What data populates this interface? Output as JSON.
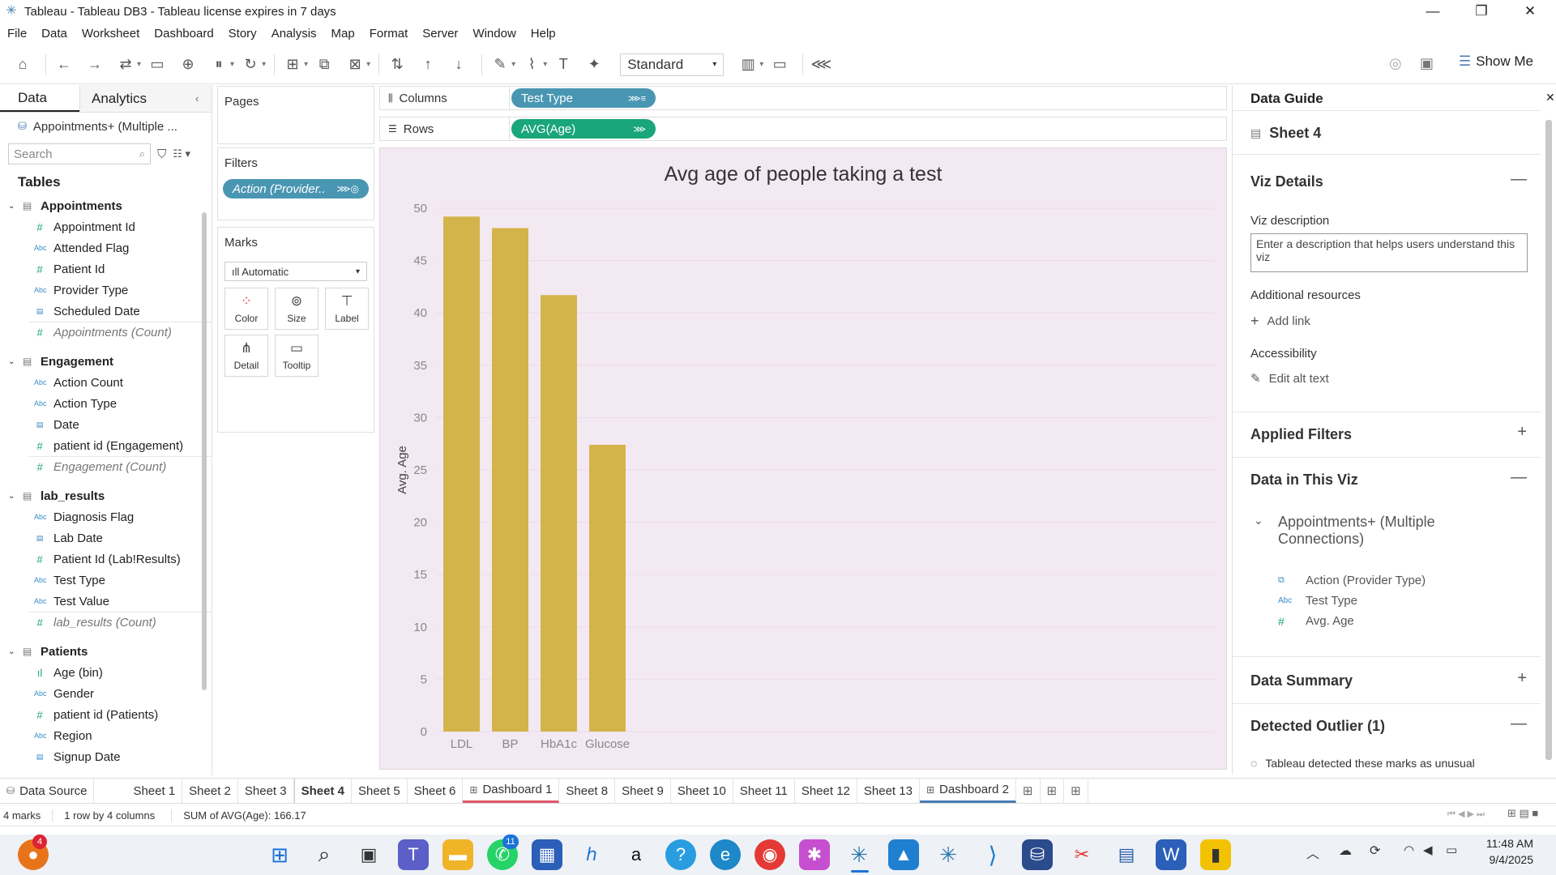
{
  "window": {
    "title": "Tableau - Tableau DB3 - Tableau license expires in 7 days",
    "minimize": "—",
    "restore": "❐",
    "close": "✕"
  },
  "menu": [
    "File",
    "Data",
    "Worksheet",
    "Dashboard",
    "Story",
    "Analysis",
    "Map",
    "Format",
    "Server",
    "Window",
    "Help"
  ],
  "toolbar": {
    "fit_select": "Standard",
    "show_me": "Show Me"
  },
  "data_pane": {
    "tab_data": "Data",
    "tab_analytics": "Analytics",
    "datasource": "Appointments+ (Multiple ...",
    "search_placeholder": "Search",
    "tables_heading": "Tables",
    "groups": [
      {
        "name": "Appointments",
        "fields": [
          {
            "icon": "#",
            "label": "Appointment Id"
          },
          {
            "icon": "Abc",
            "label": "Attended Flag"
          },
          {
            "icon": "#",
            "label": "Patient Id"
          },
          {
            "icon": "Abc",
            "label": "Provider Type"
          },
          {
            "icon": "date",
            "label": "Scheduled Date"
          },
          {
            "icon": "#",
            "label": "Appointments (Count)",
            "italic": true
          }
        ]
      },
      {
        "name": "Engagement",
        "fields": [
          {
            "icon": "Abc",
            "label": "Action Count"
          },
          {
            "icon": "Abc",
            "label": "Action Type"
          },
          {
            "icon": "date",
            "label": "Date"
          },
          {
            "icon": "#",
            "label": "patient id (Engagement)"
          },
          {
            "icon": "#",
            "label": "Engagement (Count)",
            "italic": true
          }
        ]
      },
      {
        "name": "lab_results",
        "fields": [
          {
            "icon": "Abc",
            "label": "Diagnosis Flag"
          },
          {
            "icon": "date",
            "label": "Lab Date"
          },
          {
            "icon": "#",
            "label": "Patient Id (Lab!Results)"
          },
          {
            "icon": "Abc",
            "label": "Test Type"
          },
          {
            "icon": "Abc",
            "label": "Test Value"
          },
          {
            "icon": "#",
            "label": "lab_results (Count)",
            "italic": true
          }
        ]
      },
      {
        "name": "Patients",
        "fields": [
          {
            "icon": "bin",
            "label": "Age (bin)"
          },
          {
            "icon": "Abc",
            "label": "Gender"
          },
          {
            "icon": "#",
            "label": "patient id (Patients)"
          },
          {
            "icon": "Abc",
            "label": "Region"
          },
          {
            "icon": "date",
            "label": "Signup Date"
          }
        ]
      }
    ]
  },
  "shelves": {
    "pages": "Pages",
    "filters": "Filters",
    "filter_pill": "Action (Provider..",
    "marks": "Marks",
    "marks_type": "Automatic",
    "mark_buttons": [
      "Color",
      "Size",
      "Label",
      "Detail",
      "Tooltip"
    ],
    "columns_label": "Columns",
    "rows_label": "Rows",
    "columns_pill": "Test Type",
    "rows_pill": "AVG(Age)"
  },
  "chart_data": {
    "type": "bar",
    "title": "Avg age of people taking a test",
    "ylabel": "Avg. Age",
    "xlabel": "",
    "categories": [
      "LDL",
      "BP",
      "HbA1c",
      "Glucose"
    ],
    "values": [
      49.2,
      48.1,
      41.7,
      27.4
    ],
    "ylim": [
      0,
      50
    ],
    "yticks": [
      0,
      5,
      10,
      15,
      20,
      25,
      30,
      35,
      40,
      45,
      50
    ],
    "bar_color": "#d4b44a",
    "background": "#f3e9f2"
  },
  "data_guide": {
    "title": "Data Guide",
    "sheet": "Sheet 4",
    "viz_details": "Viz Details",
    "viz_description_label": "Viz description",
    "viz_description_placeholder": "Enter a description that helps users understand this viz",
    "additional_resources": "Additional resources",
    "add_link": "Add link",
    "accessibility": "Accessibility",
    "edit_alt_text": "Edit alt text",
    "applied_filters": "Applied Filters",
    "data_in_viz": "Data in This Viz",
    "datasource_full": "Appointments+ (Multiple Connections)",
    "viz_fields": [
      {
        "icon": "Abc",
        "label": "Action (Provider Type)"
      },
      {
        "icon": "Abc",
        "label": "Test Type"
      },
      {
        "icon": "#",
        "label": "Avg. Age"
      }
    ],
    "data_summary": "Data Summary",
    "detected_outlier": "Detected Outlier (1)",
    "outlier_text": "Tableau detected these marks as unusual"
  },
  "sheet_tabs": [
    "Data Source",
    "Sheet 1",
    "Sheet 2",
    "Sheet 3",
    "Sheet 4",
    "Sheet 5",
    "Sheet 6",
    "Dashboard 1",
    "Sheet 8",
    "Sheet 9",
    "Sheet 10",
    "Sheet 11",
    "Sheet 12",
    "Sheet 13",
    "Dashboard 2"
  ],
  "active_tab": "Sheet 4",
  "status": {
    "marks": "4 marks",
    "dims": "1 row by 4 columns",
    "sum": "SUM of AVG(Age): 166.17"
  },
  "taskbar": {
    "badge_notifications": "4",
    "badge_whatsapp": "11",
    "time": "11:48 AM",
    "date": "9/4/2025"
  }
}
